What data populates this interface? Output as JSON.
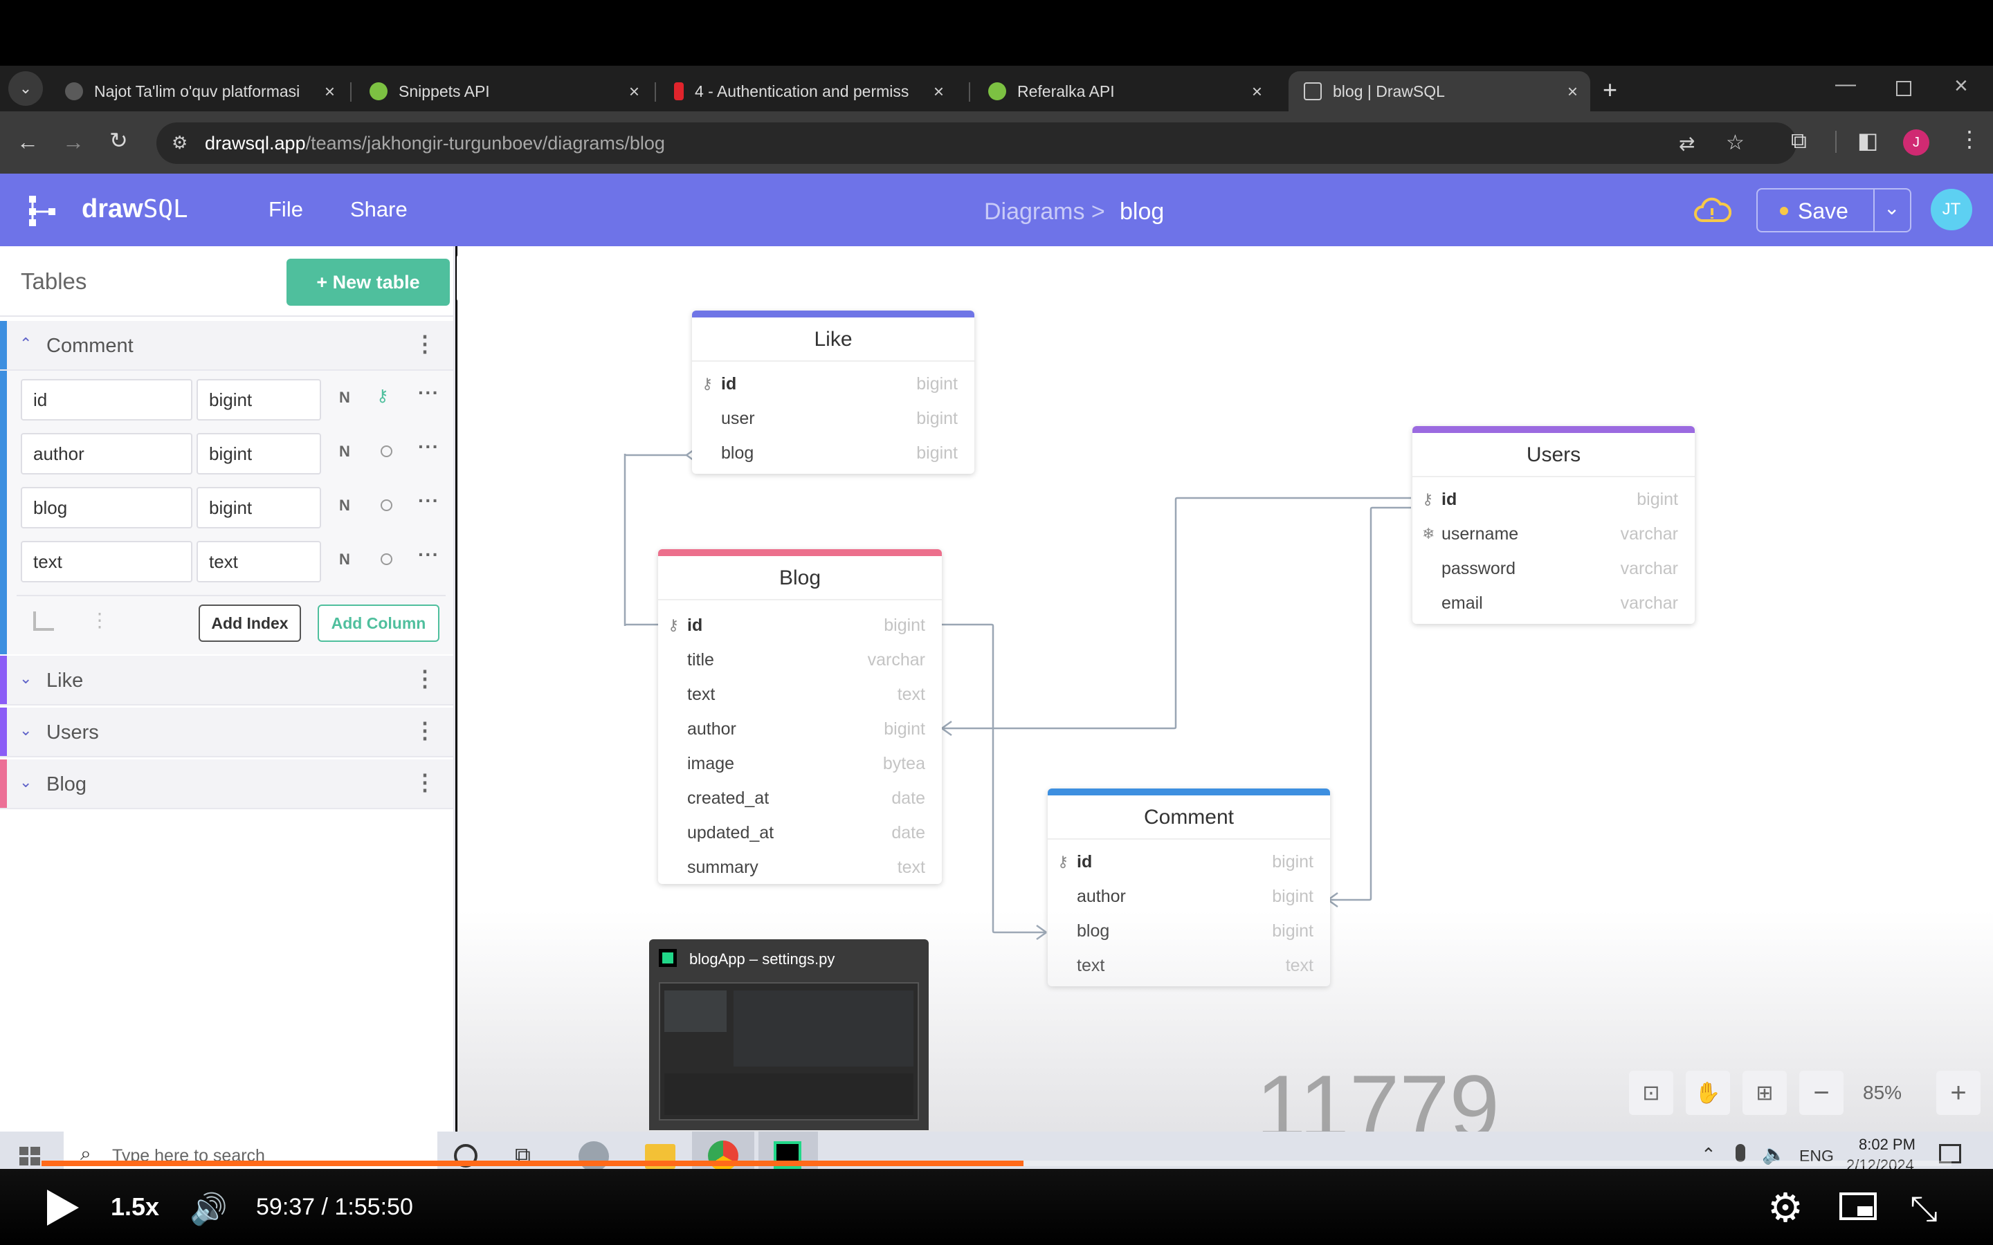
{
  "browser": {
    "tabs": [
      {
        "title": "Najot Ta'lim o'quv platformasi",
        "favicon_color": "#5a5a5a"
      },
      {
        "title": "Snippets API",
        "favicon_color": "#7cc142"
      },
      {
        "title": "4 - Authentication and permissi",
        "favicon_color": "#e0242c"
      },
      {
        "title": "Referalka API",
        "favicon_color": "#7cc142"
      },
      {
        "title": "blog | DrawSQL",
        "favicon_color": "#3d3d3d"
      }
    ],
    "url_host": "drawsql.app",
    "url_path": "/teams/jakhongir-turgunboev/diagrams/blog",
    "avatar_letter": "J"
  },
  "app": {
    "logo_bold": "draw",
    "logo_light": "SQL",
    "menu": [
      "File",
      "Share"
    ],
    "breadcrumb_parent": "Diagrams >",
    "breadcrumb_current": "blog",
    "save_label": "Save",
    "user_initials": "JT",
    "accent": "#6e73e8"
  },
  "sidebar": {
    "title": "Tables",
    "new_table_label": "+ New table",
    "expanded": {
      "name": "Comment",
      "columns": [
        {
          "name": "id",
          "type": "bigint",
          "nullable": "N",
          "primary": true
        },
        {
          "name": "author",
          "type": "bigint",
          "nullable": "N",
          "primary": false
        },
        {
          "name": "blog",
          "type": "bigint",
          "nullable": "N",
          "primary": false
        },
        {
          "name": "text",
          "type": "text",
          "nullable": "N",
          "primary": false
        }
      ],
      "add_index_label": "Add Index",
      "add_column_label": "Add Column"
    },
    "collapsed": [
      {
        "name": "Like",
        "color": "#8b5cf6"
      },
      {
        "name": "Users",
        "color": "#8b5cf6"
      },
      {
        "name": "Blog",
        "color": "#ec6f96"
      }
    ]
  },
  "diagram": {
    "tables": [
      {
        "name": "Like",
        "color": "#6f75e6",
        "fields": [
          {
            "name": "id",
            "type": "bigint",
            "key": true
          },
          {
            "name": "user",
            "type": "bigint",
            "key": false
          },
          {
            "name": "blog",
            "type": "bigint",
            "key": false
          }
        ]
      },
      {
        "name": "Blog",
        "color": "#ec6f8c",
        "fields": [
          {
            "name": "id",
            "type": "bigint",
            "key": true
          },
          {
            "name": "title",
            "type": "varchar",
            "key": false
          },
          {
            "name": "text",
            "type": "text",
            "key": false
          },
          {
            "name": "author",
            "type": "bigint",
            "key": false
          },
          {
            "name": "image",
            "type": "bytea",
            "key": false
          },
          {
            "name": "created_at",
            "type": "date",
            "key": false
          },
          {
            "name": "updated_at",
            "type": "date",
            "key": false
          },
          {
            "name": "summary",
            "type": "text",
            "key": false
          }
        ]
      },
      {
        "name": "Users",
        "color": "#9b6ae0",
        "fields": [
          {
            "name": "id",
            "type": "bigint",
            "key": true
          },
          {
            "name": "username",
            "type": "varchar",
            "key": false
          },
          {
            "name": "password",
            "type": "varchar",
            "key": false
          },
          {
            "name": "email",
            "type": "varchar",
            "key": false
          }
        ]
      },
      {
        "name": "Comment",
        "color": "#3d8fe0",
        "fields": [
          {
            "name": "id",
            "type": "bigint",
            "key": true
          },
          {
            "name": "author",
            "type": "bigint",
            "key": false
          },
          {
            "name": "blog",
            "type": "bigint",
            "key": false
          },
          {
            "name": "text",
            "type": "text",
            "key": false
          }
        ]
      }
    ],
    "zoom": "85%",
    "overlay_number": "11779"
  },
  "taskbar": {
    "search_placeholder": "Type here to search",
    "lang": "ENG",
    "time": "8:02 PM",
    "date": "2/12/2024",
    "preview_title": "blogApp – settings.py"
  },
  "video": {
    "speed": "1.5x",
    "time": "59:37 / 1:55:50",
    "progress_fraction": 0.514
  }
}
